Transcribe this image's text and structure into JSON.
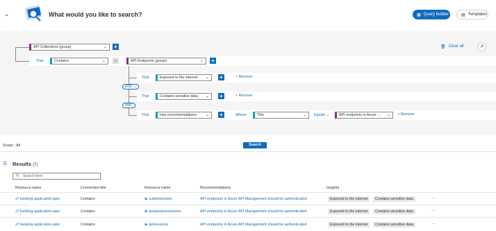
{
  "header": {
    "title": "What would you like to search?",
    "query_builder": "Query builder",
    "templates": "Templates"
  },
  "builder": {
    "clear_all": "Clear all",
    "root_select": "API Collections (group)",
    "that": "That",
    "contains_select": "Contains",
    "endpoints_select": "API Endpoints (group)",
    "and": "AND",
    "remove": "Remove",
    "where": "Where",
    "equals": "Equals",
    "conditions": [
      {
        "that": "That",
        "value": "Exposed to the internet"
      },
      {
        "that": "That",
        "value": "Contains sensitive data"
      },
      {
        "that": "That",
        "value": "Has recommendations"
      }
    ],
    "where_field": "Title",
    "where_value": "API endpoints in Azure ..."
  },
  "scope": "Scope : All",
  "search_button": "Search",
  "results": {
    "title": "Results",
    "count": "(7)",
    "search_placeholder": "Search item",
    "columns": [
      "Resource name",
      "Connection title",
      "Resource name",
      "Recommendations",
      "Insights"
    ],
    "rows": [
      {
        "resource": "banking-application-apis",
        "connection": "Contains",
        "resource2": "submitsession",
        "recommendation": "API endpoints in Azure API Management should be authenticated",
        "insight1": "Exposed to the internet",
        "insight2": "Contains sensitive data"
      },
      {
        "resource": "banking-application-apis",
        "connection": "Contains",
        "resource2": "getspeakersessions",
        "recommendation": "API endpoints in Azure API Management should be authenticated",
        "insight1": "Exposed to the internet",
        "insight2": "Contains sensitive data"
      },
      {
        "resource": "banking-application-apis",
        "connection": "Contains",
        "resource2": "getsessions",
        "recommendation": "API endpoints in Azure API Management should be authenticated",
        "insight1": "Exposed to the internet",
        "insight2": "Contains sensitive data"
      }
    ],
    "more": "..."
  },
  "colors": {
    "accent": "#0f6cbd",
    "group": "#8a2a8a",
    "teal": "#00a8a8"
  }
}
